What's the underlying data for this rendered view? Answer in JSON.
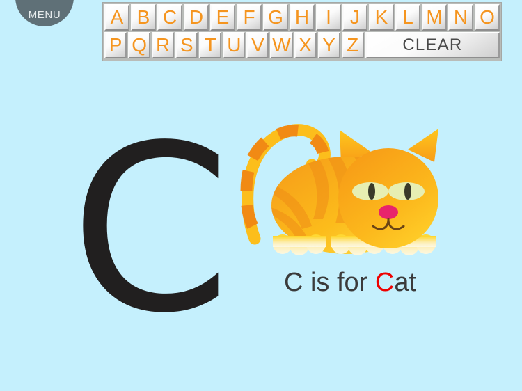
{
  "colors": {
    "background": "#c5f0fd",
    "menu_bg": "#5f7077",
    "key_letter": "#f5951f",
    "clear_text": "#4a4a4a",
    "big_letter": "#211f1f",
    "caption_text": "#3b3b3b",
    "caption_highlight": "#ee0000",
    "cat_orange": "#f5a01e",
    "cat_yellow": "#ffd21e",
    "cat_stripe": "#ef8d16",
    "cat_paw": "#fdf3c9",
    "cat_nose": "#e8246b",
    "cat_eye": "#e7eeb2",
    "cat_pupil": "#3a3a2a"
  },
  "menu": {
    "label": "MENU",
    "icon": "menu-circle"
  },
  "keyboard": {
    "rows": [
      [
        "A",
        "B",
        "C",
        "D",
        "E",
        "F",
        "G",
        "H",
        "I",
        "J",
        "K",
        "L",
        "M",
        "N",
        "O"
      ],
      [
        "P",
        "Q",
        "R",
        "S",
        "T",
        "U",
        "V",
        "W",
        "X",
        "Y",
        "Z"
      ]
    ],
    "clear_label": "CLEAR"
  },
  "stage": {
    "selected_letter": "C",
    "caption": {
      "prefix": "C is for ",
      "highlight": "C",
      "suffix": "at",
      "full_text": "C is for Cat"
    },
    "illustration": {
      "name": "cat-illustration",
      "subject": "Cat"
    }
  }
}
